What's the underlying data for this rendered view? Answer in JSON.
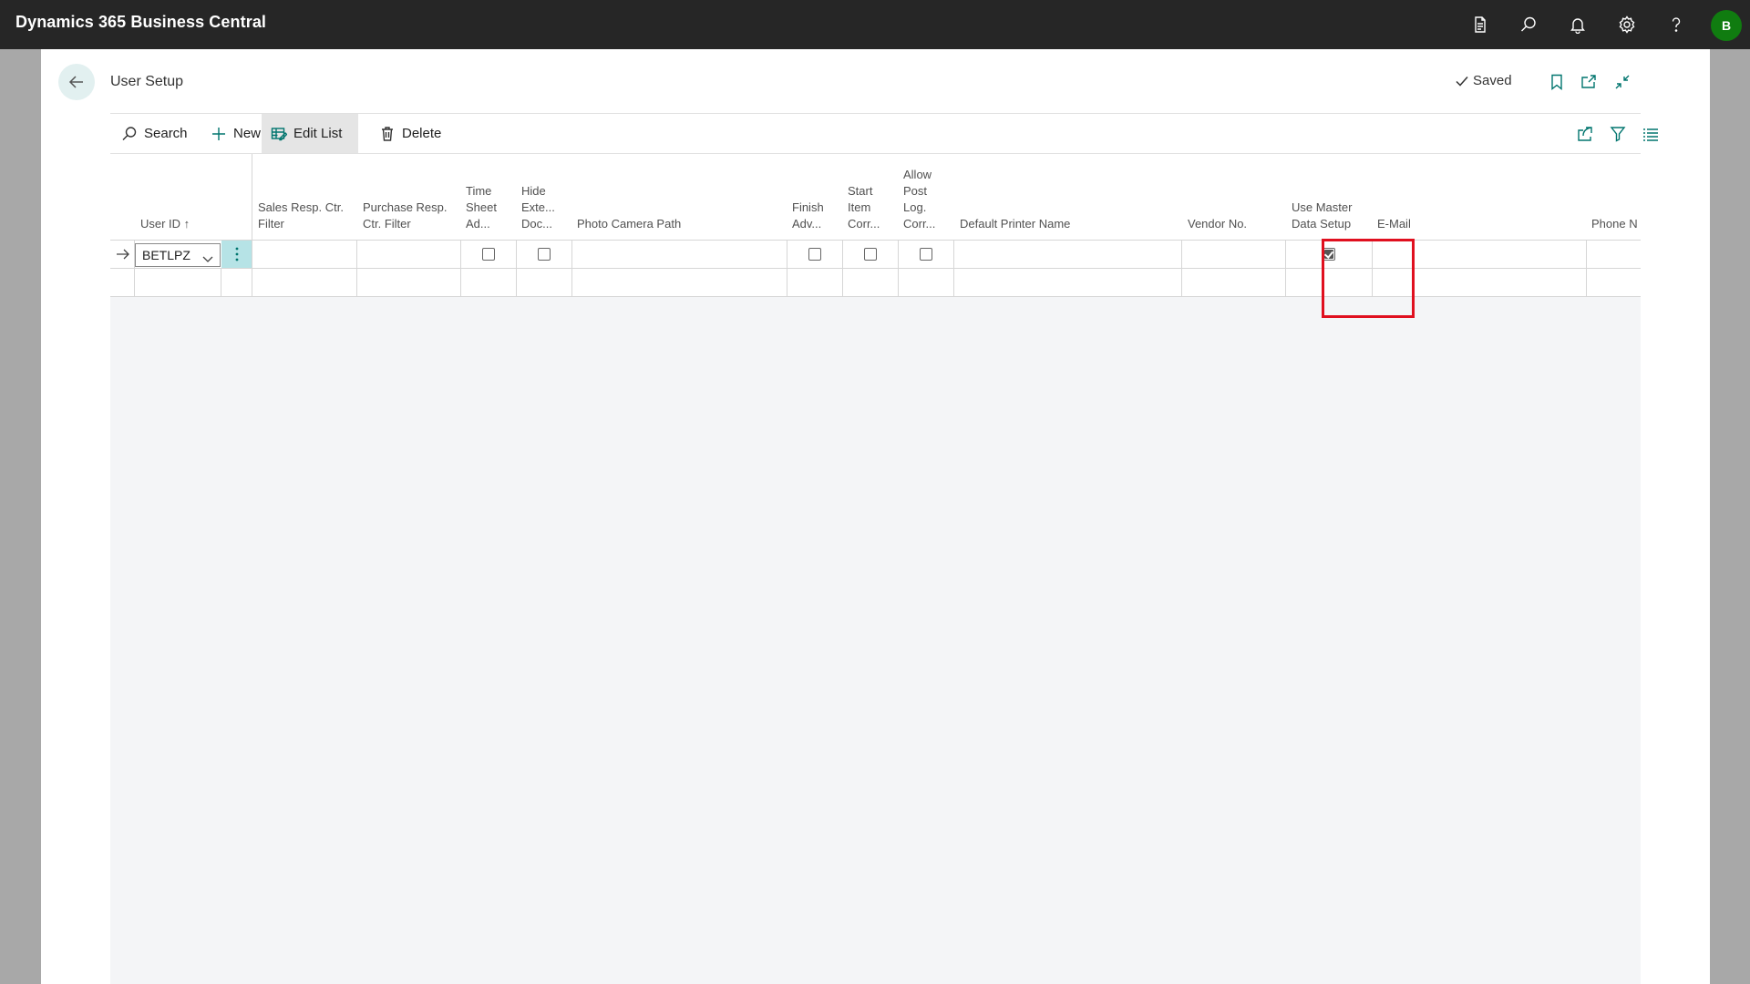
{
  "app": {
    "title": "Dynamics 365 Business Central",
    "avatar_initial": "B",
    "avatar_color": "#107c10"
  },
  "topbar_icons": [
    "report-icon",
    "search-icon",
    "bell-icon",
    "gear-icon",
    "help-icon"
  ],
  "page": {
    "title": "User Setup",
    "status": "Saved"
  },
  "actions": {
    "search": "Search",
    "new": "New",
    "edit_list": "Edit List",
    "delete": "Delete"
  },
  "columns": {
    "user_id": "User ID ↑",
    "sales_resp": "Sales Resp. Ctr.\nFilter",
    "purchase_resp": "Purchase Resp.\nCtr. Filter",
    "time_sheet": "Time\nSheet\nAd...",
    "hide_ext": "Hide\nExte...\nDoc...",
    "photo_camera": "Photo Camera Path",
    "finish_adv": "Finish\nAdv...",
    "start_item": "Start\nItem\nCorr...",
    "allow_post": "Allow\nPost\nLog.\nCorr...",
    "default_printer": "Default Printer Name",
    "vendor_no": "Vendor No.",
    "use_master": "Use Master\nData Setup",
    "email": "E-Mail",
    "phone": "Phone N"
  },
  "rows": [
    {
      "user_id": "BETLPZ",
      "time_sheet": false,
      "hide_ext": false,
      "finish_adv": false,
      "start_item": false,
      "allow_post": false,
      "use_master": true
    }
  ],
  "highlight_color": "#e0101f"
}
